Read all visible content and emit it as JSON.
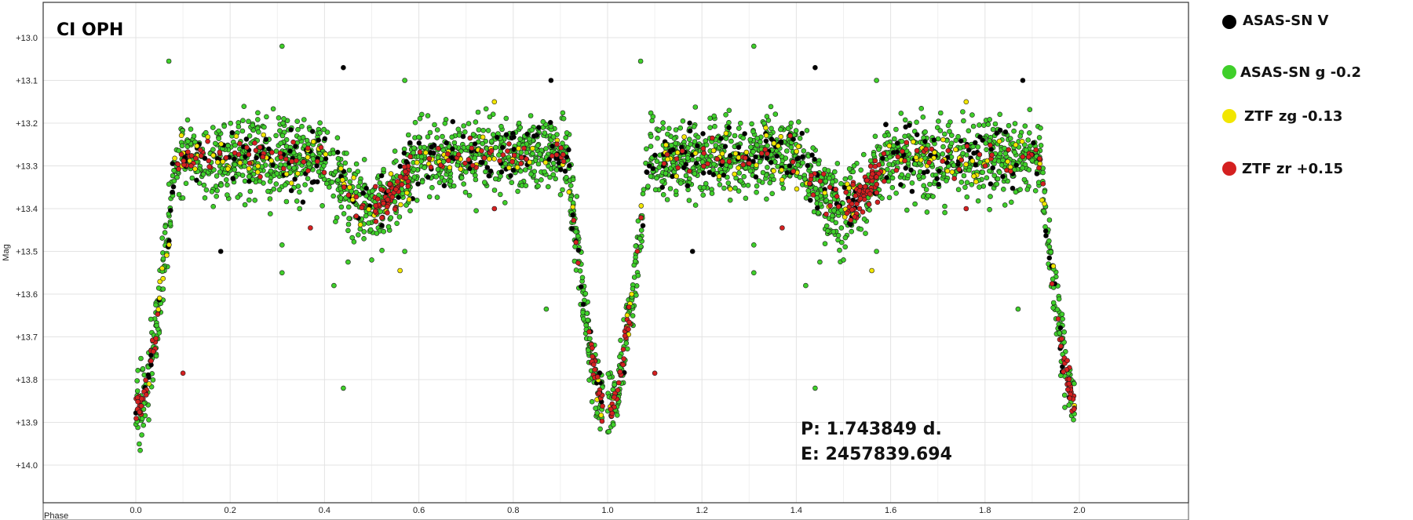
{
  "chart_data": {
    "type": "scatter",
    "title": "CI OPH",
    "xlabel": "Phase",
    "ylabel": "Mag",
    "xlim": [
      -0.2,
      2.2
    ],
    "ylim": [
      14.07,
      12.93
    ],
    "y_inverted": true,
    "grid": true,
    "x_ticks": [
      "0.0",
      "0.2",
      "0.4",
      "0.6",
      "0.8",
      "1.0",
      "1.2",
      "1.4",
      "1.6",
      "1.8",
      "2.0"
    ],
    "x_tick_values": [
      0.0,
      0.2,
      0.4,
      0.6,
      0.8,
      1.0,
      1.2,
      1.4,
      1.6,
      1.8,
      2.0
    ],
    "y_ticks": [
      "+13.0",
      "+13.1",
      "+13.2",
      "+13.3",
      "+13.4",
      "+13.5",
      "+13.6",
      "+13.7",
      "+13.8",
      "+13.9",
      "+14.0"
    ],
    "y_tick_values": [
      13.0,
      13.1,
      13.2,
      13.3,
      13.4,
      13.5,
      13.6,
      13.7,
      13.8,
      13.9,
      14.0
    ],
    "legend_position": "right",
    "annotations": [
      "P: 1.743849 d.",
      "E: 2457839.694"
    ],
    "light_curve_model": {
      "maximum_mag": 13.28,
      "primary_minimum": {
        "phase": 0.0,
        "mag": 13.88
      },
      "secondary_minimum": {
        "phase": 0.5,
        "mag": 13.4
      },
      "eclipse_half_width": 0.085,
      "secondary_half_width": 0.1
    },
    "series": [
      {
        "name": "ASAS-SN V",
        "color": "#000000",
        "approx_points_per_cycle": 160,
        "scatter_mag": 0.035,
        "outliers": [
          {
            "x": 0.44,
            "y": 13.07
          },
          {
            "x": 0.88,
            "y": 13.1
          },
          {
            "x": 0.18,
            "y": 13.5
          },
          {
            "x": 1.44,
            "y": 13.07
          },
          {
            "x": 1.88,
            "y": 13.1
          },
          {
            "x": 1.18,
            "y": 13.5
          }
        ]
      },
      {
        "name": "ASAS-SN g -0.2",
        "color": "#3fcf2a",
        "approx_points_per_cycle": 1300,
        "scatter_mag": 0.045,
        "outliers": [
          {
            "x": 0.31,
            "y": 13.02
          },
          {
            "x": 0.07,
            "y": 13.055
          },
          {
            "x": 0.57,
            "y": 13.1
          },
          {
            "x": 0.31,
            "y": 13.485
          },
          {
            "x": 0.31,
            "y": 13.55
          },
          {
            "x": 0.42,
            "y": 13.58
          },
          {
            "x": 0.44,
            "y": 13.82
          },
          {
            "x": 0.87,
            "y": 13.635
          },
          {
            "x": 0.57,
            "y": 13.5
          },
          {
            "x": 0.45,
            "y": 13.525
          },
          {
            "x": 0.5,
            "y": 13.52
          },
          {
            "x": 1.31,
            "y": 13.02
          },
          {
            "x": 1.07,
            "y": 13.055
          },
          {
            "x": 1.57,
            "y": 13.1
          },
          {
            "x": 1.31,
            "y": 13.485
          },
          {
            "x": 1.31,
            "y": 13.55
          },
          {
            "x": 1.42,
            "y": 13.58
          },
          {
            "x": 1.44,
            "y": 13.82
          },
          {
            "x": 1.87,
            "y": 13.635
          },
          {
            "x": 1.57,
            "y": 13.5
          },
          {
            "x": 1.45,
            "y": 13.525
          },
          {
            "x": 1.5,
            "y": 13.52
          }
        ]
      },
      {
        "name": "ZTF zg -0.13",
        "color": "#f2e600",
        "approx_points_per_cycle": 90,
        "scatter_mag": 0.03,
        "outliers": [
          {
            "x": 0.56,
            "y": 13.545
          },
          {
            "x": 1.56,
            "y": 13.545
          },
          {
            "x": 0.76,
            "y": 13.15
          },
          {
            "x": 1.76,
            "y": 13.15
          }
        ]
      },
      {
        "name": "ZTF zr +0.15",
        "color": "#d42020",
        "approx_points_per_cycle": 200,
        "scatter_mag": 0.02,
        "outliers": [
          {
            "x": 0.1,
            "y": 13.785
          },
          {
            "x": 0.37,
            "y": 13.445
          },
          {
            "x": 0.76,
            "y": 13.4
          },
          {
            "x": 1.1,
            "y": 13.785
          },
          {
            "x": 1.37,
            "y": 13.445
          },
          {
            "x": 1.76,
            "y": 13.4
          }
        ]
      }
    ]
  }
}
